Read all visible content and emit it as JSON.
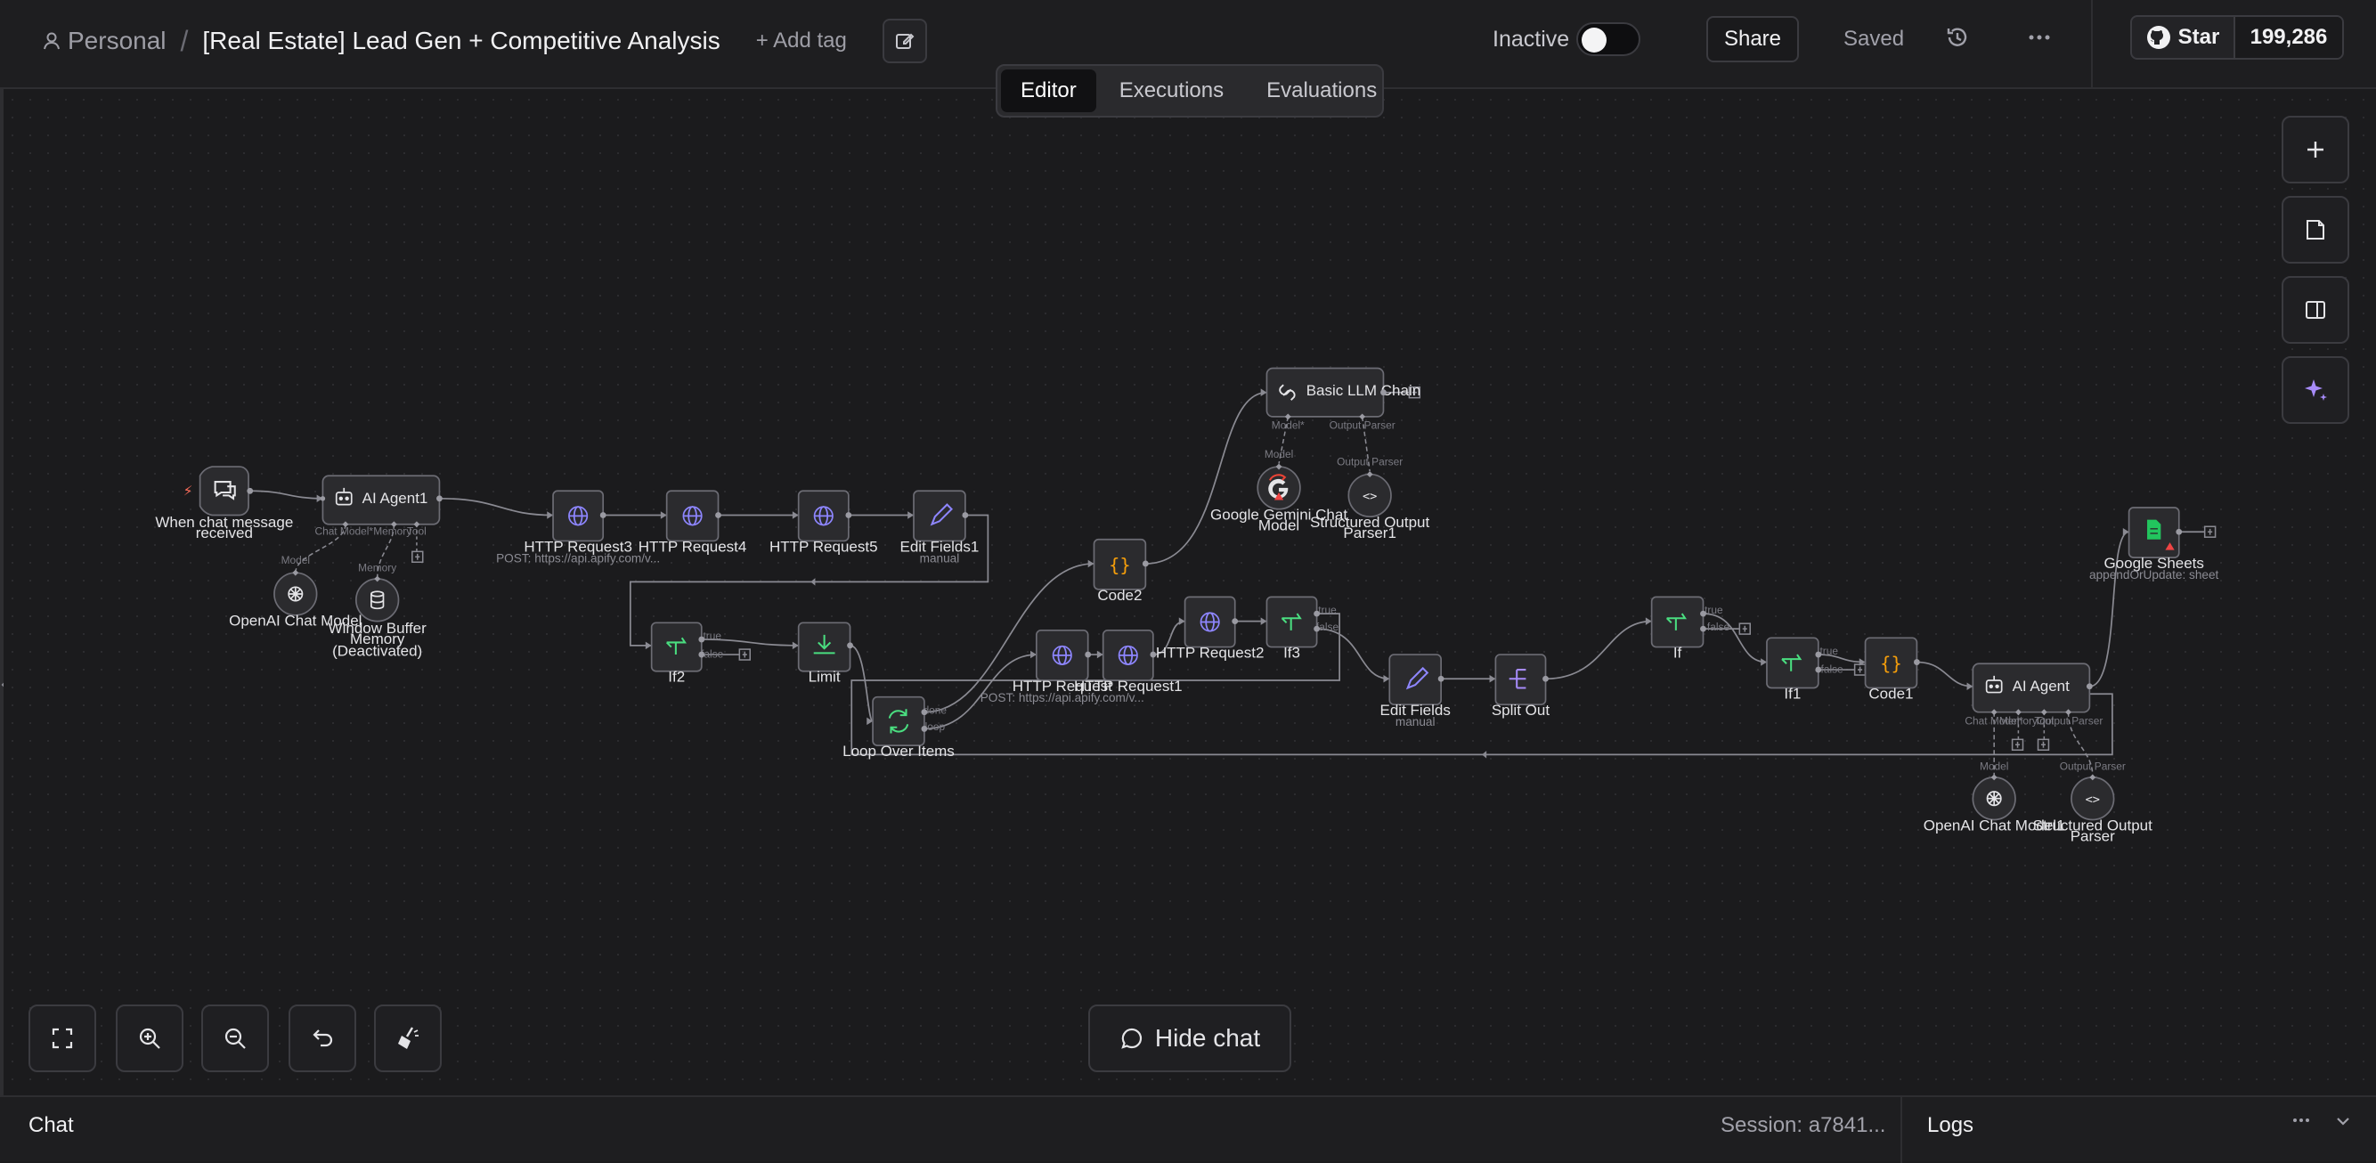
{
  "header": {
    "breadcrumb_project": "Personal",
    "breadcrumb_separator": "/",
    "workflow_title": "[Real Estate] Lead Gen + Competitive Analysis",
    "add_tag": "+ Add tag",
    "active_status": "Inactive",
    "active_toggle_on": false,
    "share": "Share",
    "saved": "Saved",
    "github_star": "Star",
    "github_count": "199,286"
  },
  "tabs": [
    {
      "label": "Editor",
      "active": true
    },
    {
      "label": "Executions",
      "active": false
    },
    {
      "label": "Evaluations",
      "active": false
    }
  ],
  "canvas_controls": {
    "hide_chat": "Hide chat"
  },
  "bottom_panel": {
    "chat": "Chat",
    "session": "Session: a7841...",
    "logs": "Logs"
  },
  "nodes": [
    {
      "id": "trigger",
      "name": "When chat message received",
      "name2": "received",
      "icon": "chat-icon"
    },
    {
      "id": "agent1",
      "name": "AI Agent1",
      "ports": [
        "Chat Model*",
        "Memory",
        "Tool"
      ],
      "icon": "robot-icon"
    },
    {
      "id": "openai1",
      "name": "OpenAI Chat Model",
      "port_in": "Model",
      "icon": "openai-icon"
    },
    {
      "id": "memory",
      "name": "Window Buffer",
      "name2": "Memory",
      "name3": "(Deactivated)",
      "port_in": "Memory",
      "icon": "database-icon"
    },
    {
      "id": "http3",
      "name": "HTTP Request3",
      "sub": "POST: https://api.apify.com/v...",
      "icon": "globe-icon"
    },
    {
      "id": "http4",
      "name": "HTTP Request4",
      "icon": "globe-icon"
    },
    {
      "id": "http5",
      "name": "HTTP Request5",
      "icon": "globe-icon"
    },
    {
      "id": "edit1",
      "name": "Edit Fields1",
      "sub": "manual",
      "icon": "pencil-icon"
    },
    {
      "id": "if2",
      "name": "If2",
      "branches": [
        "true",
        "false"
      ],
      "icon": "branch-icon"
    },
    {
      "id": "limit",
      "name": "Limit",
      "icon": "limit-icon"
    },
    {
      "id": "loop",
      "name": "Loop Over Items",
      "branches": [
        "done",
        "loop"
      ],
      "icon": "loop-icon"
    },
    {
      "id": "code2",
      "name": "Code2",
      "icon": "code-icon"
    },
    {
      "id": "llmchain",
      "name": "Basic LLM Chain",
      "ports": [
        "Model*",
        "Output Parser"
      ],
      "icon": "link-icon"
    },
    {
      "id": "gemini",
      "name": "Google Gemini Chat",
      "name2": "Model",
      "port_in": "Model",
      "icon": "google-icon"
    },
    {
      "id": "parser1",
      "name": "Structured Output",
      "name2": "Parser1",
      "port_in": "Output Parser",
      "icon": "braces-icon"
    },
    {
      "id": "http",
      "name": "HTTP Request",
      "sub": "POST: https://api.apify.com/v...",
      "icon": "globe-icon"
    },
    {
      "id": "http1",
      "name": "HTTP Request1",
      "icon": "globe-icon"
    },
    {
      "id": "http2",
      "name": "HTTP Request2",
      "icon": "globe-icon"
    },
    {
      "id": "if3",
      "name": "If3",
      "branches": [
        "true",
        "false"
      ],
      "icon": "branch-icon"
    },
    {
      "id": "edit",
      "name": "Edit Fields",
      "sub": "manual",
      "icon": "pencil-icon"
    },
    {
      "id": "split",
      "name": "Split Out",
      "icon": "split-icon"
    },
    {
      "id": "if",
      "name": "If",
      "branches": [
        "true",
        "false"
      ],
      "icon": "branch-icon"
    },
    {
      "id": "if1",
      "name": "If1",
      "branches": [
        "true",
        "false"
      ],
      "icon": "branch-icon"
    },
    {
      "id": "code1",
      "name": "Code1",
      "icon": "code-icon"
    },
    {
      "id": "agent",
      "name": "AI Agent",
      "ports": [
        "Chat Model*",
        "Memory",
        "Tool",
        "Output Parser"
      ],
      "icon": "robot-icon"
    },
    {
      "id": "openai2",
      "name": "OpenAI Chat Model1",
      "port_in": "Model",
      "icon": "openai-icon"
    },
    {
      "id": "parser",
      "name": "Structured Output",
      "name2": "Parser",
      "port_in": "Output Parser",
      "icon": "braces-icon"
    },
    {
      "id": "sheets",
      "name": "Google Sheets",
      "sub": "appendOrUpdate: sheet",
      "icon": "sheets-icon"
    }
  ]
}
